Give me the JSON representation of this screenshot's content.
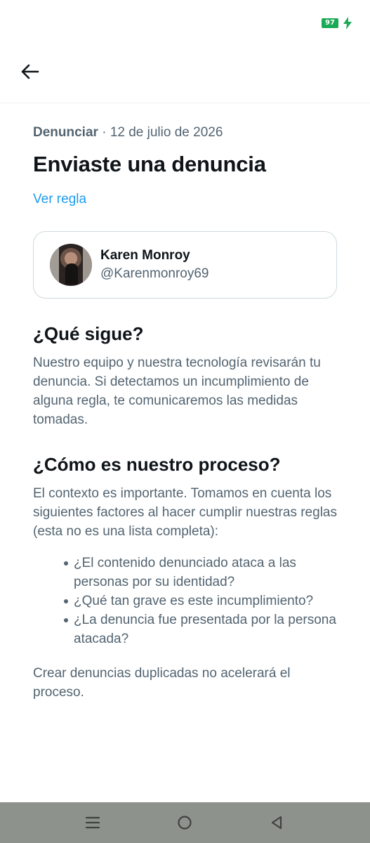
{
  "status_bar": {
    "battery_level": "97"
  },
  "header": {
    "back_icon": "arrow-left-icon"
  },
  "report": {
    "category": "Denunciar",
    "separator": "·",
    "date": "12 de julio de 2026",
    "title": "Enviaste una denuncia",
    "rule_link": "Ver regla"
  },
  "reported_user": {
    "name": "Karen Monroy",
    "handle": "@Karenmonroy69"
  },
  "next_steps": {
    "title": "¿Qué sigue?",
    "body": "Nuestro equipo y nuestra tecnología revisarán tu denuncia. Si detectamos un incumplimiento de alguna regla, te comunicaremos las medidas tomadas."
  },
  "process": {
    "title": "¿Cómo es nuestro proceso?",
    "body": "El contexto es importante. Tomamos en cuenta los siguientes factores al hacer cumplir nuestras reglas (esta no es una lista completa):",
    "bullets": [
      "¿El contenido denunciado ataca a las personas por su identidad?",
      "¿Qué tan grave es este incumplimiento?",
      "¿La denuncia fue presentada por la persona atacada?"
    ],
    "note": "Crear denuncias duplicadas no acelerará el proceso."
  },
  "colors": {
    "link": "#1d9bf0",
    "text_primary": "#0f1419",
    "text_secondary": "#536471",
    "battery": "#1aaa55",
    "nav_bar": "#8e928c"
  }
}
